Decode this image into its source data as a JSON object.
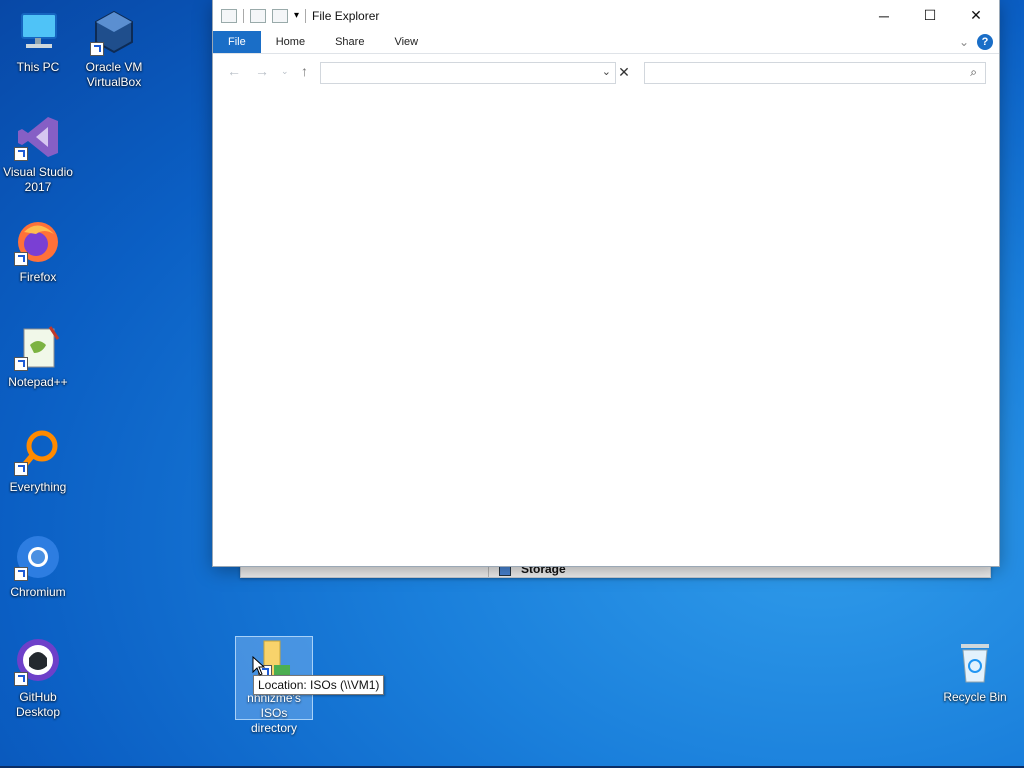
{
  "desktop": {
    "icons": [
      {
        "label": "This PC"
      },
      {
        "label": "Oracle VM\nVirtualBox"
      },
      {
        "label": "Visual Studio\n2017"
      },
      {
        "label": "Firefox"
      },
      {
        "label": "Notepad++"
      },
      {
        "label": "Everything"
      },
      {
        "label": "Chromium"
      },
      {
        "label": "GitHub\nDesktop"
      },
      {
        "label": "nhnizme's\nISOs directory"
      },
      {
        "label": "Recycle Bin"
      }
    ],
    "tooltip": "Location: ISOs (\\\\VM1)"
  },
  "explorer": {
    "title": "File Explorer",
    "tabs": [
      "File",
      "Home",
      "Share",
      "View"
    ],
    "help_label": "?",
    "address_value": "",
    "search_placeholder": ""
  },
  "background_window": {
    "storage_label": "Storage"
  }
}
